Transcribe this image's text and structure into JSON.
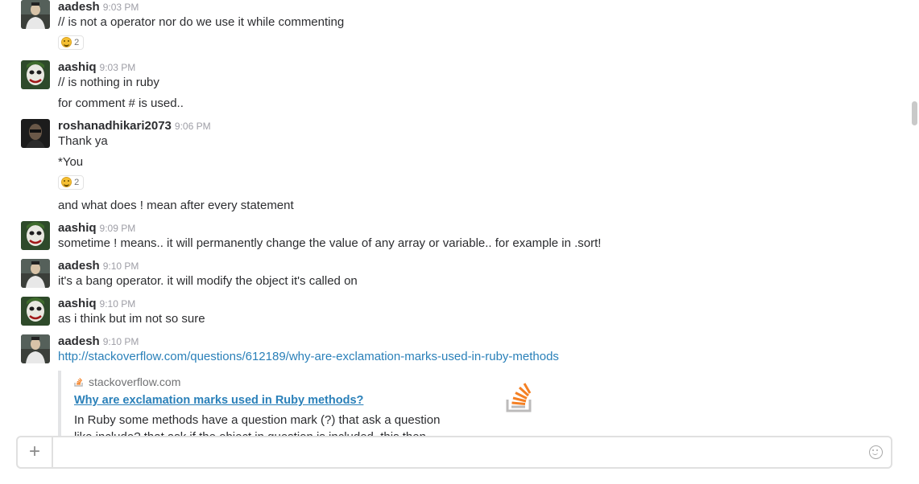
{
  "messages": [
    {
      "sender": "aadesh",
      "time": "9:03 PM",
      "lines": [
        "// is not a operator nor do we use it while commenting"
      ],
      "reaction": {
        "icon": "smile-emoji-icon",
        "count": "2"
      }
    },
    {
      "sender": "aashiq",
      "time": "9:03 PM",
      "lines": [
        "// is nothing in ruby",
        "for comment # is used.."
      ]
    },
    {
      "sender": "roshanadhikari2073",
      "time": "9:06 PM",
      "lines": [
        "Thank ya",
        "*You",
        "and what does ! mean after every statement"
      ],
      "reaction": {
        "icon": "smile-emoji-icon",
        "count": "2"
      }
    },
    {
      "sender": "aashiq",
      "time": "9:09 PM",
      "lines": [
        "sometime ! means.. it will permanently change the value of any array or variable.. for example in .sort!"
      ]
    },
    {
      "sender": "aadesh",
      "time": "9:10 PM",
      "lines": [
        "it's a bang operator. it will modify the object it's called on"
      ]
    },
    {
      "sender": "aashiq",
      "time": "9:10 PM",
      "lines": [
        "as i think but im not so sure"
      ]
    },
    {
      "sender": "aadesh",
      "time": "9:10 PM",
      "link": "http://stackoverflow.com/questions/612189/why-are-exclamation-marks-used-in-ruby-methods",
      "attachment": {
        "site": "stackoverflow.com",
        "title": "Why are exclamation marks used in Ruby methods?",
        "description": "In Ruby some methods have a question mark (?) that ask a question like include? that ask if the object in question is included, this then returns a"
      }
    }
  ],
  "composer": {
    "plus_label": "+",
    "placeholder": ""
  },
  "colors": {
    "link": "#2a80b9",
    "sender": "#2c2d30",
    "timestamp": "#9e9ea6",
    "stackoverflow_orange": "#f48024"
  }
}
